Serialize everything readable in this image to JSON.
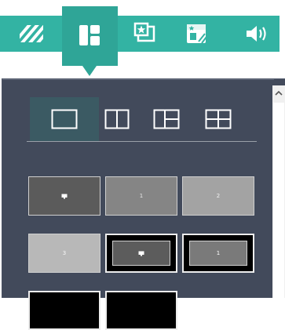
{
  "toolbar": {
    "items": [
      {
        "icon": "hatch-stripes-icon"
      },
      {
        "icon": "layout-grid-icon",
        "active": true
      },
      {
        "icon": "star-frame-icon"
      },
      {
        "icon": "star-window-icon"
      },
      {
        "icon": "speaker-volume-icon"
      }
    ],
    "color": "#33b3a3",
    "active_color": "#2fa597"
  },
  "layouts": {
    "options": [
      "single",
      "two-columns",
      "one-plus-two",
      "quad"
    ],
    "selected": "single"
  },
  "monitors": {
    "row1": [
      {
        "label": "",
        "icon": "display-icon"
      },
      {
        "label": "1"
      },
      {
        "label": "2"
      }
    ],
    "row2": [
      {
        "label": "3"
      },
      {
        "label": "",
        "icon": "display-icon"
      },
      {
        "label": "1"
      }
    ]
  },
  "colors": {
    "panel": "#424a5b",
    "selected_layout": "#3b5a63"
  }
}
